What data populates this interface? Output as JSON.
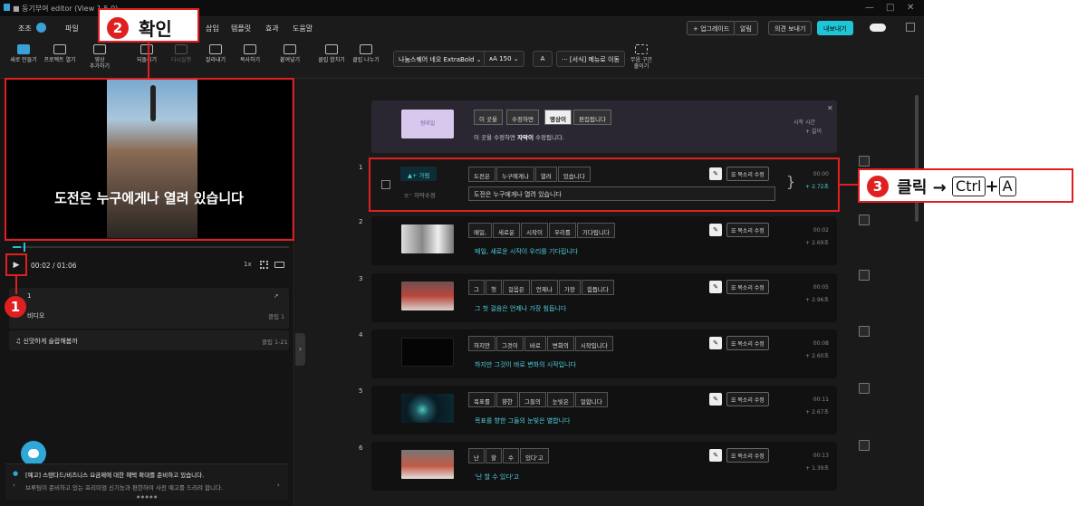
{
  "app": {
    "title": "■ 동기부여 editor (View 1.5.0)",
    "window_controls": [
      "—",
      "□",
      "✕"
    ]
  },
  "menubar": {
    "items": [
      "조조",
      "파일",
      "삽입",
      "템플릿",
      "효과",
      "도움말"
    ],
    "upgrade": "+ 업그레이드",
    "alarm": "알림",
    "feedback": "의견 보내기",
    "share": "내보내기"
  },
  "toolbar": {
    "tools": [
      {
        "label": "새로 만들기",
        "dim": false
      },
      {
        "label": "프로젝트 열기",
        "dim": false
      },
      {
        "label": "영상\n추가하기",
        "dim": false
      },
      {
        "label": "되돌리기",
        "dim": false
      },
      {
        "label": "다시실행",
        "dim": true
      },
      {
        "label": "잘라내기",
        "dim": false
      },
      {
        "label": "복사하기",
        "dim": false
      },
      {
        "label": "붙여넣기",
        "dim": false
      },
      {
        "label": "클립 합치기",
        "dim": false
      },
      {
        "label": "클립 나누기",
        "dim": false
      }
    ],
    "font_name": "나눔스퀘어 네오 ExtraBold ⌄",
    "font_size": "150 ⌄",
    "text_tools": "··· [서식] 메뉴로 이동",
    "silence_tool": "무음 구간\n줄이기"
  },
  "preview": {
    "subtitle": "도전은 누구에게나 열려 있습니다",
    "seek_progress": 0.03
  },
  "player": {
    "play_icon": "▶",
    "current_time": "00:02",
    "total_time": "01:06",
    "speed": "1x"
  },
  "panels": {
    "rows": [
      {
        "label": "1",
        "right": "↗"
      },
      {
        "label": "비디오",
        "right": "클립 1"
      },
      {
        "label": "♫  신맛하게 슬랍해봅까",
        "right": "클립 1-21"
      }
    ]
  },
  "notice": {
    "title": "[예고] 스탠다드/비즈니스 요금제에 대한 혜택 확대를 준비하고 있습니다.",
    "body": "브루팀이 준비하고 있는 프리미엄 신기능과 편한하여 사전 예고를 드리려 합니다.",
    "dots": "● ● ● ● ●"
  },
  "placeholder": {
    "thumb": "썸네일",
    "chips": [
      "이 곳을",
      "수정하면",
      "영상이",
      "편집됩니다"
    ],
    "active_chip": 2,
    "line_pre": "이 곳을 수정하면 ",
    "line_bold": "자막이",
    "line_post": " 수정됩니다.",
    "side1": "시작 시간",
    "side2": "+ 길이",
    "close": "✕"
  },
  "clips": [
    {
      "num": "1",
      "chips": [
        "도전은",
        "누구에게나",
        "열려",
        "있습니다"
      ],
      "text": "도전은 누구에게나 열려 있습니다",
      "time": "00:00",
      "dur": "+ 2.72초",
      "tag1": "▲+ 가림",
      "tag2": "≡⁺ 자막수정"
    },
    {
      "num": "2",
      "chips": [
        "매일,",
        "새로운",
        "시작이",
        "우리를",
        "기다립니다"
      ],
      "text": "매일, 새로운 시작이 우리를 기다립니다",
      "time": "00:02",
      "dur": "+ 2.69초"
    },
    {
      "num": "3",
      "chips": [
        "그",
        "첫",
        "걸음은",
        "언제나",
        "가장",
        "힘듭니다"
      ],
      "text": "그 첫 걸음은 언제나 가장 힘듭니다",
      "time": "00:05",
      "dur": "+ 2.96초"
    },
    {
      "num": "4",
      "chips": [
        "하지만",
        "그것이",
        "바로",
        "변화의",
        "시작입니다"
      ],
      "text": "하지만 그것이 바로 변화의 시작입니다",
      "time": "00:08",
      "dur": "+ 2.60초"
    },
    {
      "num": "5",
      "chips": [
        "목표를",
        "향한",
        "그들의",
        "눈빛은",
        "얼합니다"
      ],
      "text": "목표를 향한 그들의 눈빛은 별합니다",
      "time": "00:11",
      "dur": "+ 2.67초"
    },
    {
      "num": "6",
      "chips": [
        "난",
        "할",
        "수",
        "있다'고"
      ],
      "text": "'난 할 수 있다'고",
      "time": "00:13",
      "dur": "+ 1.39초"
    }
  ],
  "clip_actions": {
    "pen": "✎",
    "voice": "☰ 목소리 수정"
  },
  "annotations": {
    "b1": "1",
    "b2": "2",
    "b2_text": "확인",
    "b3": "3",
    "b3_text": "클릭 →",
    "key_ctrl": "Ctrl",
    "plus": "+",
    "key_a": "A"
  }
}
